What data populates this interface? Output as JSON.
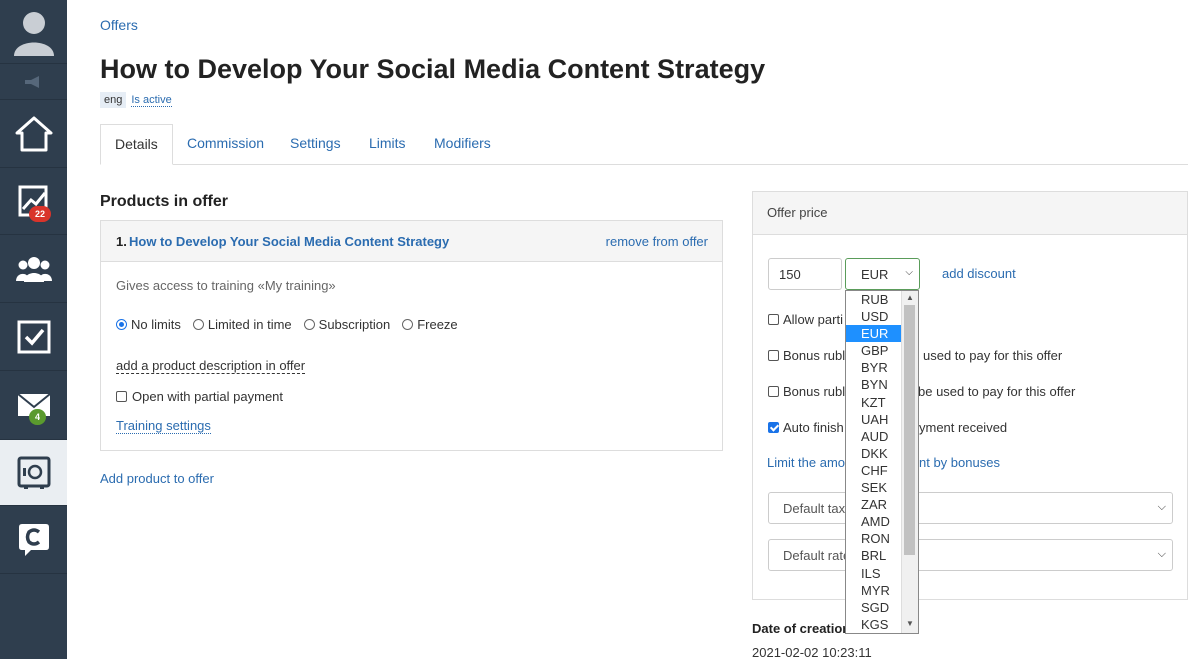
{
  "sidebar": {
    "badges": {
      "analytics": "22",
      "mail": "4"
    },
    "colors": {
      "bg": "#2f3e4e",
      "badge_red": "#d9342b",
      "badge_green": "#5a9a2e"
    }
  },
  "breadcrumb": "Offers",
  "title": "How to Develop Your Social Media Content Strategy",
  "tags": {
    "lang": "eng",
    "status": "Is active"
  },
  "tabs": [
    "Details",
    "Commission",
    "Settings",
    "Limits",
    "Modifiers"
  ],
  "products": {
    "section_title": "Products in offer",
    "item": {
      "number": "1.",
      "name": "How to Develop Your Social Media Content Strategy",
      "remove": "remove from offer",
      "gives": "Gives access to training «My training»",
      "radios": [
        "No limits",
        "Limited in time",
        "Subscription",
        "Freeze"
      ],
      "add_description": "add a product description in offer",
      "partial_payment": "Open with partial payment",
      "training_settings": "Training settings"
    },
    "add_product": "Add product to offer"
  },
  "offer_price": {
    "header": "Offer price",
    "price": "150",
    "currency": "EUR",
    "add_discount": "add discount",
    "checkboxes": [
      {
        "left": "Allow parti",
        "right": ""
      },
      {
        "left": "Bonus rubl",
        "right": "used to pay for this offer"
      },
      {
        "left": "Bonus rubl",
        "right": "be used to pay for this offer"
      },
      {
        "left": "Auto finish",
        "right": "yment received"
      }
    ],
    "limit_link": {
      "left": "Limit the amo",
      "right": "nt by bonuses"
    },
    "selects": [
      "Default tax",
      "Default rate"
    ]
  },
  "currency_options": [
    "RUB",
    "USD",
    "EUR",
    "GBP",
    "BYR",
    "BYN",
    "KZT",
    "UAH",
    "AUD",
    "DKK",
    "CHF",
    "SEK",
    "ZAR",
    "AMD",
    "RON",
    "BRL",
    "ILS",
    "MYR",
    "SGD",
    "KGS"
  ],
  "date": {
    "label": "Date of creation",
    "value": "2021-02-02 10:23:11"
  }
}
